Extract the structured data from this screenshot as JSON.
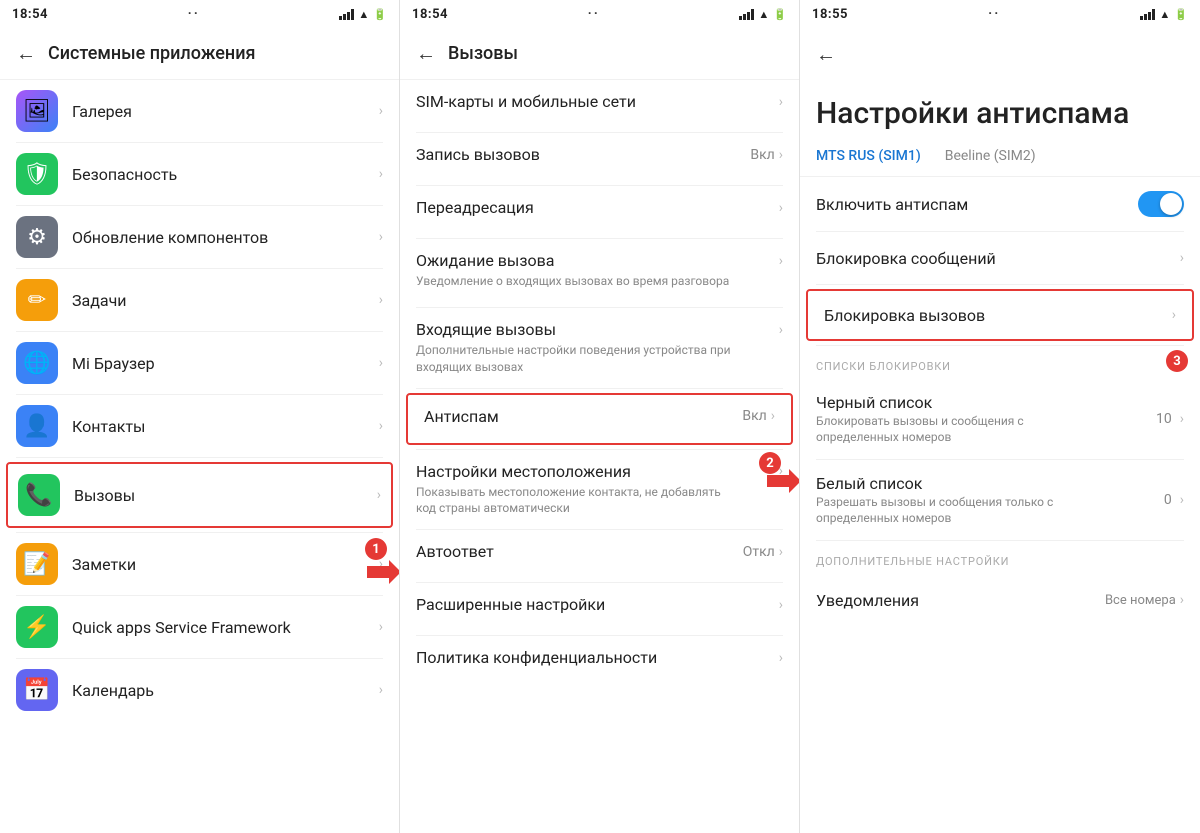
{
  "panels": {
    "left": {
      "statusBar": {
        "time": "18:54",
        "dots": "··"
      },
      "topBar": {
        "backLabel": "←",
        "title": "Системные приложения"
      },
      "items": [
        {
          "id": "gallery",
          "iconClass": "icon-gallery",
          "iconEmoji": "🖼",
          "label": "Галерея",
          "highlighted": false
        },
        {
          "id": "security",
          "iconClass": "icon-security",
          "iconEmoji": "🛡",
          "label": "Безопасность",
          "highlighted": false
        },
        {
          "id": "update",
          "iconClass": "icon-update",
          "iconEmoji": "⚙",
          "label": "Обновление компонентов",
          "highlighted": false
        },
        {
          "id": "tasks",
          "iconClass": "icon-tasks",
          "iconEmoji": "✏",
          "label": "Задачи",
          "highlighted": false
        },
        {
          "id": "browser",
          "iconClass": "icon-browser",
          "iconEmoji": "🌐",
          "label": "Mi Браузер",
          "highlighted": false
        },
        {
          "id": "contacts",
          "iconClass": "icon-contacts",
          "iconEmoji": "👤",
          "label": "Контакты",
          "highlighted": false
        },
        {
          "id": "calls",
          "iconClass": "icon-calls",
          "iconEmoji": "📞",
          "label": "Вызовы",
          "highlighted": true
        },
        {
          "id": "notes",
          "iconClass": "icon-notes",
          "iconEmoji": "📝",
          "label": "Заметки",
          "highlighted": false
        },
        {
          "id": "quickapps",
          "iconClass": "icon-quickapps",
          "iconEmoji": "⚡",
          "label": "Quick apps Service Framework",
          "highlighted": false
        },
        {
          "id": "calendar",
          "iconClass": "icon-calendar",
          "iconEmoji": "📅",
          "label": "Календарь",
          "highlighted": false
        }
      ],
      "badge1": "1",
      "arrowLabel": "→"
    },
    "mid": {
      "statusBar": {
        "time": "18:54",
        "dots": "··"
      },
      "topBar": {
        "backLabel": "←",
        "title": "Вызовы"
      },
      "items": [
        {
          "id": "sim",
          "title": "SIM-карты и мобильные сети",
          "sub": "",
          "status": "",
          "highlighted": false
        },
        {
          "id": "record",
          "title": "Запись вызовов",
          "sub": "",
          "status": "Вкл",
          "highlighted": false
        },
        {
          "id": "redirect",
          "title": "Переадресация",
          "sub": "",
          "status": "",
          "highlighted": false
        },
        {
          "id": "waiting",
          "title": "Ожидание вызова",
          "sub": "Уведомление о входящих вызовах во время разговора",
          "status": "",
          "highlighted": false
        },
        {
          "id": "incoming",
          "title": "Входящие вызовы",
          "sub": "Дополнительные настройки поведения устройства при входящих вызовах",
          "status": "",
          "highlighted": false
        },
        {
          "id": "antispam",
          "title": "Антиспам",
          "sub": "",
          "status": "Вкл",
          "highlighted": true
        },
        {
          "id": "location",
          "title": "Настройки местоположения",
          "sub": "Показывать местоположение контакта, не добавлять код страны автоматически",
          "status": "",
          "highlighted": false
        },
        {
          "id": "autoanswer",
          "title": "Автоответ",
          "sub": "",
          "status": "Откл",
          "highlighted": false
        },
        {
          "id": "advanced",
          "title": "Расширенные настройки",
          "sub": "",
          "status": "",
          "highlighted": false
        },
        {
          "id": "privacy",
          "title": "Политика конфиденциальности",
          "sub": "",
          "status": "",
          "highlighted": false
        }
      ],
      "badge2": "2",
      "arrowLabel": "→"
    },
    "right": {
      "statusBar": {
        "time": "18:55",
        "dots": "··"
      },
      "topBar": {
        "backLabel": "←"
      },
      "bigTitle": "Настройки антиспама",
      "simTabs": [
        {
          "id": "sim1",
          "label": "MTS RUS (SIM1)",
          "active": true
        },
        {
          "id": "sim2",
          "label": "Beeline (SIM2)",
          "active": false
        }
      ],
      "toggleItem": {
        "label": "Включить антиспам",
        "value": true
      },
      "items": [
        {
          "id": "block-messages",
          "label": "Блокировка сообщений",
          "sub": "",
          "highlighted": false,
          "num": "",
          "chevron": true
        },
        {
          "id": "block-calls",
          "label": "Блокировка вызовов",
          "sub": "",
          "highlighted": true,
          "num": "",
          "chevron": true
        }
      ],
      "sectionLabel1": "СПИСКИ БЛОКИРОВКИ",
      "blockItems": [
        {
          "id": "blacklist",
          "label": "Черный список",
          "sub": "Блокировать вызовы и сообщения с определенных номеров",
          "num": "10",
          "chevron": true
        },
        {
          "id": "whitelist",
          "label": "Белый список",
          "sub": "Разрешать вызовы и сообщения только с определенных номеров",
          "num": "0",
          "chevron": true
        }
      ],
      "sectionLabel2": "ДОПОЛНИТЕЛЬНЫЕ НАСТРОЙКИ",
      "additionalItems": [
        {
          "id": "notifications",
          "label": "Уведомления",
          "status": "Все номера",
          "chevron": true
        }
      ],
      "badge3": "3",
      "arrowLabel": "→"
    }
  }
}
